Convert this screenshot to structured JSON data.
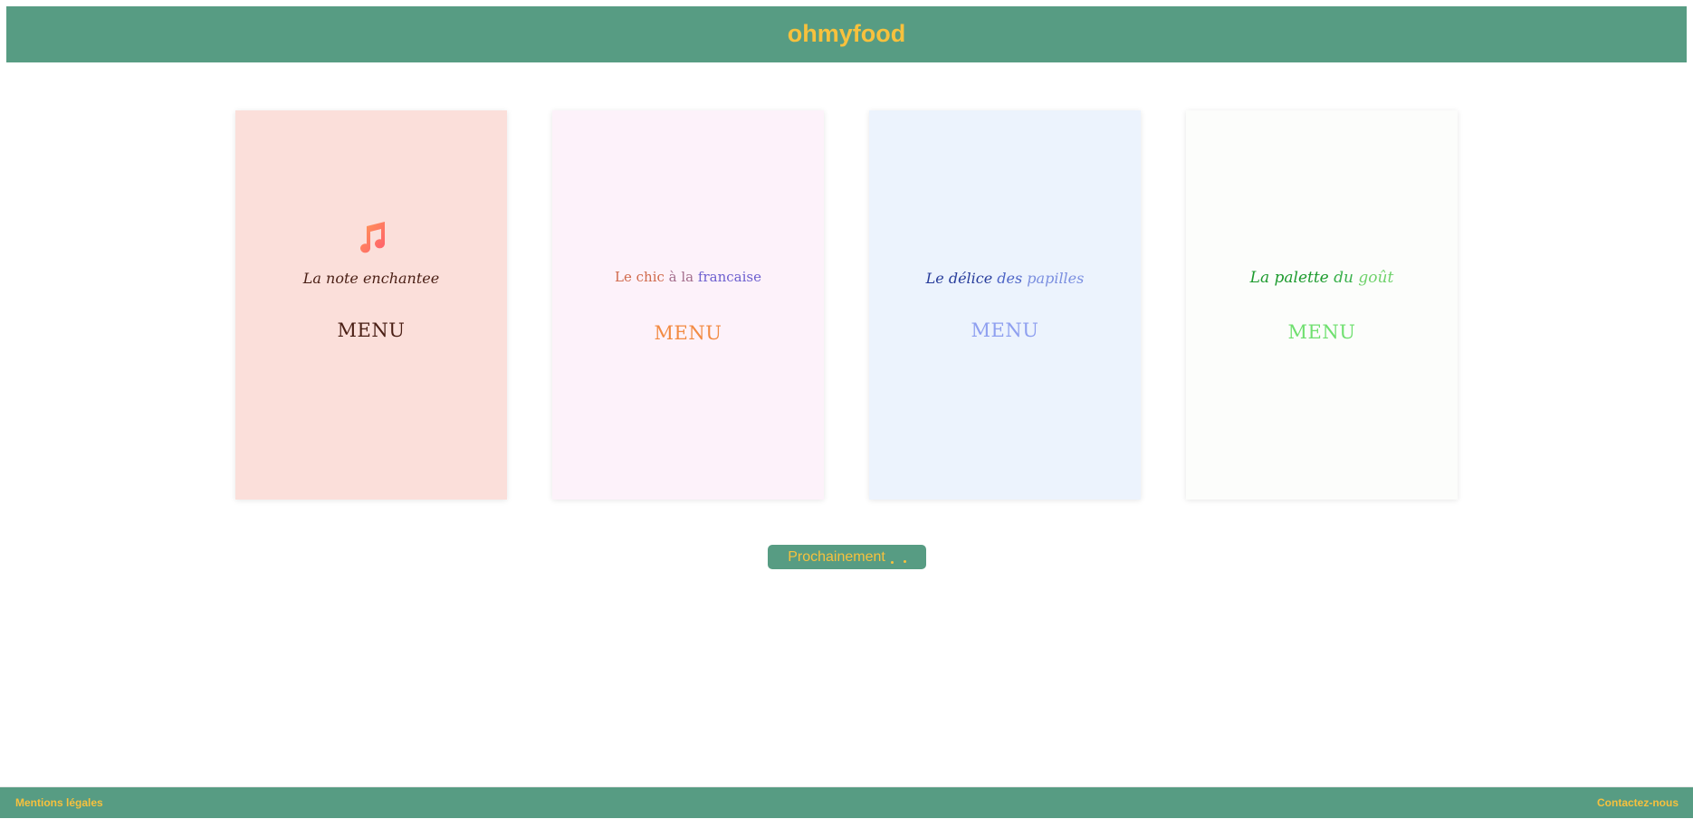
{
  "header": {
    "brand": "ohmyfood"
  },
  "cards": [
    {
      "title": "La note enchantee",
      "menu_label": "MENU",
      "icon": "music-note-icon"
    },
    {
      "title_parts": [
        "Le chic ",
        "à la ",
        "francaise"
      ],
      "menu_label": "MENU"
    },
    {
      "title_parts": [
        "Le délice ",
        "des ",
        "papilles"
      ],
      "menu_label": "MENU"
    },
    {
      "title_parts": [
        "La palette ",
        "du ",
        "goût"
      ],
      "menu_label": "MENU"
    }
  ],
  "soon_button": {
    "label": "Prochainement"
  },
  "footer": {
    "left_link": "Mentions légales",
    "right_link": "Contactez-nous"
  },
  "colors": {
    "brand_green": "#579c83",
    "brand_yellow": "#f7c13d"
  }
}
